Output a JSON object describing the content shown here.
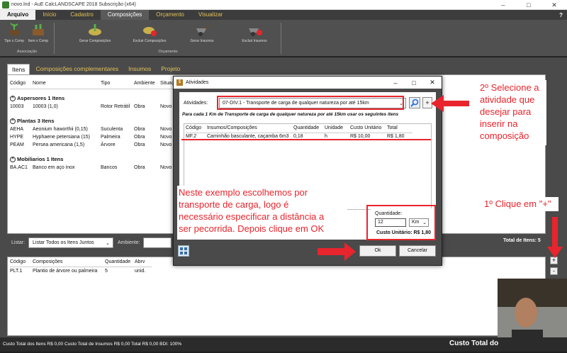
{
  "window": {
    "title": "novo.lnd - AuE CalcLANDSCAPE 2018 Subscrição (x64)",
    "help": "?"
  },
  "menu": [
    "Arquivo",
    "Início",
    "Cadastro",
    "Composições",
    "Orçamento",
    "Visualizar"
  ],
  "ribbon": {
    "buttons": [
      "Tipo x Comp",
      "Item x Comp",
      "Gerar Composições",
      "Excluir Composições",
      "Gerar Insumos",
      "Excluir Insumos"
    ],
    "groups": [
      "Associação",
      "Orçamento"
    ]
  },
  "tabs": [
    "Itens",
    "Composições complementares",
    "Insumos",
    "Projeto"
  ],
  "items_table": {
    "headers": [
      "Código",
      "Nome",
      "Tipo",
      "Ambiente",
      "Situaç"
    ],
    "groups": [
      {
        "header": "Aspersores  1 Itens",
        "rows": [
          [
            "10003",
            "10003 (1,0)",
            "Rotor Retrátil",
            "Obra",
            "Novo"
          ]
        ]
      },
      {
        "header": "Plantas  3 Itens",
        "rows": [
          [
            "AEHA",
            "Aeonium haworthii (0,15)",
            "Suculenta",
            "Obra",
            "Novo"
          ],
          [
            "HYPE",
            "Hyphaene petersiana (15)",
            "Palmeira",
            "Obra",
            "Novo"
          ],
          [
            "PEAM",
            "Persea americana (1,5)",
            "Árvore",
            "Obra",
            "Novo"
          ]
        ]
      },
      {
        "header": "Mobiliarios  1 Itens",
        "rows": [
          [
            "BA.AC1",
            "Banco em aço inox",
            "Bancos",
            "Obra",
            "Novo"
          ]
        ]
      }
    ],
    "collapse_symbol": "^"
  },
  "list_bar": {
    "label": "Listar:",
    "select": "Listar Todos os Itens Juntos",
    "ambiente_label": "Ambiente:",
    "total": "Total de Itens: 5"
  },
  "comp_table": {
    "headers": [
      "Código",
      "Composições",
      "Quantidade",
      "Abrv"
    ],
    "rows": [
      [
        "PLT.1",
        "Plantio de árvore ou palmeira",
        "5",
        "unid."
      ]
    ]
  },
  "side_buttons": {
    "plus": "+",
    "minus": "-"
  },
  "status": {
    "left": "Custo Total dos Itens R$ 0,00   Custo Total de Insumos R$ 0,00   Total R$ 0,00   BDI: 100%",
    "right": "Custo Total do"
  },
  "dialog": {
    "title": "Atividades",
    "activity_label": "Atividades:",
    "activity_value": "07-DIV.1 - Transporte de carga de qualquer natureza por até 15km",
    "search_icon": "search-icon",
    "plus": "+",
    "desc": "Para cada 1 Km de Transporte de carga de qualquer natureza por até 15km usar os seguintes itens",
    "headers": [
      "Código",
      "Insumos/Composições",
      "Quantidade",
      "Unidade",
      "Custo Unitário",
      "Total"
    ],
    "rows": [
      [
        "MF.2",
        "Caminhão basculante, caçamba 6m3",
        "0,18",
        "h",
        "R$ 10,00",
        "R$ 1,80"
      ]
    ],
    "qty_label": "Quantidade:",
    "qty_value": "12",
    "unit_value": "Km",
    "cost_label": "Custo Unitário: R$ 1,80",
    "ok": "Ok",
    "cancel": "Cancelar"
  },
  "annotations": {
    "step2": [
      "2º Selecione a",
      "atividade que",
      "desejar para",
      "inserir na",
      "composição"
    ],
    "step1": "1º Clique em \"+\"",
    "example": [
      "Neste exemplo escolhemos por",
      "transporte de carga, logo é",
      "necessário especificar a distância a",
      "ser pecorrida. Depois clique em OK"
    ],
    "color": "#e8242c"
  }
}
